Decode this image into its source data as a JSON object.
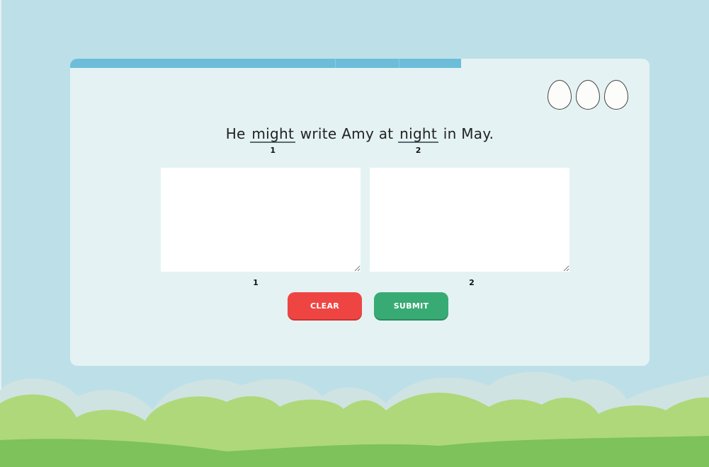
{
  "progress": {
    "value": 0.675,
    "segments": 3
  },
  "lives": {
    "count": 3,
    "icon": "egg-icon"
  },
  "sentence": {
    "parts": [
      {
        "text": "He ",
        "target": false
      },
      {
        "text": "might",
        "target": true,
        "number": "1"
      },
      {
        "text": " write Amy at ",
        "target": false
      },
      {
        "text": "night",
        "target": true,
        "number": "2"
      },
      {
        "text": " in May.",
        "target": false
      }
    ]
  },
  "answers": {
    "box1": {
      "label": "1",
      "value": ""
    },
    "box2": {
      "label": "2",
      "value": ""
    }
  },
  "buttons": {
    "clear_label": "CLEAR",
    "submit_label": "SUBMIT"
  },
  "colors": {
    "sky": "#bde0e8",
    "card": "#e4f2f3",
    "progress": "#6cbdd9",
    "clear": "#ee4543",
    "submit": "#37ab73",
    "hill_back": "#cfe3e2",
    "hill_mid": "#afd87a",
    "hill_front": "#7dc25a"
  }
}
